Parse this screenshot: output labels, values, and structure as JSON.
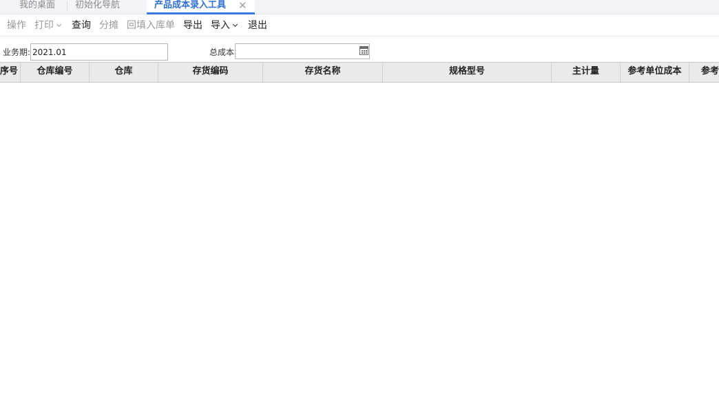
{
  "tabs": [
    {
      "label": "我的桌面"
    },
    {
      "label": "初始化导航"
    },
    {
      "label": "产品成本录入工具",
      "close": "✕"
    }
  ],
  "toolbar": {
    "operate": "操作",
    "print": "打印",
    "query": "查询",
    "allocate": "分摊",
    "backfill": "回填入库单",
    "export": "导出",
    "import": "导入",
    "exit": "退出"
  },
  "filters": {
    "period_label": "业务期:",
    "period_value": "2021.01",
    "total_cost_label": "总成本",
    "total_cost_value": ""
  },
  "grid": {
    "columns": [
      "序号",
      "仓库编号",
      "仓库",
      "存货编码",
      "存货名称",
      "规格型号",
      "主计量",
      "参考单位成本",
      "参考"
    ]
  },
  "colors": {
    "accent": "#3a7be0",
    "header_bg": "#eaeaea"
  }
}
